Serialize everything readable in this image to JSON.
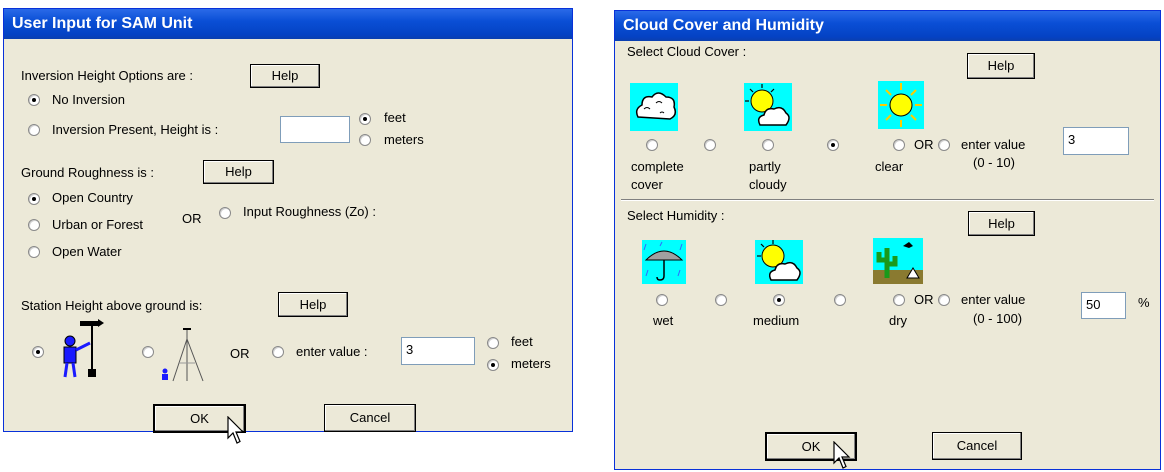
{
  "sam": {
    "title": "User Input for SAM Unit",
    "inversion_label": "Inversion Height Options are :",
    "help": "Help",
    "no_inversion": "No Inversion",
    "inversion_present": "Inversion Present,  Height is :",
    "feet": "feet",
    "meters": "meters",
    "ground_label": "Ground Roughness is :",
    "open_country": "Open Country",
    "urban_forest": "Urban or Forest",
    "open_water": "Open Water",
    "or": "OR",
    "input_roughness": "Input Roughness (Zo) :",
    "station_label": "Station Height above ground is:",
    "enter_value": "enter value :",
    "station_value": "3",
    "ok": "OK",
    "cancel": "Cancel"
  },
  "cloud": {
    "title": "Cloud Cover and Humidity",
    "select_cloud": "Select Cloud Cover :",
    "help": "Help",
    "complete_cover_1": "complete",
    "complete_cover_2": "cover",
    "partly_cloudy_1": "partly",
    "partly_cloudy_2": "cloudy",
    "clear": "clear",
    "or": "OR",
    "enter_value": "enter value",
    "cloud_range": "(0 - 10)",
    "cloud_value": "3",
    "select_humidity": "Select Humidity :",
    "wet": "wet",
    "medium": "medium",
    "dry": "dry",
    "humidity_range": "(0 - 100)",
    "humidity_value": "50",
    "percent": "%",
    "ok": "OK",
    "cancel": "Cancel"
  },
  "colors": {
    "title_blue": "#0a4fd6",
    "dialog_bg": "#ece9d8",
    "icon_bg": "#00ffff"
  }
}
